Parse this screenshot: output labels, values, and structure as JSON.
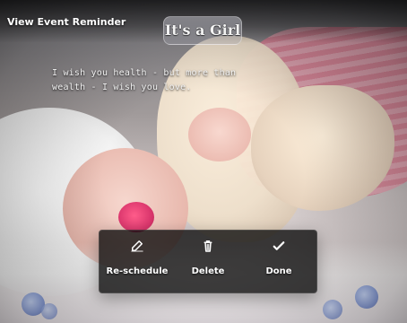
{
  "window": {
    "title": "View Event Reminder"
  },
  "header_banner": {
    "text": "It's a Girl"
  },
  "reminder": {
    "message_lines": [
      "I wish you health - but more than",
      "wealth - I wish you love."
    ]
  },
  "actions": {
    "reschedule": {
      "label": "Re-schedule",
      "icon": "edit-icon"
    },
    "delete": {
      "label": "Delete",
      "icon": "trash-icon"
    },
    "done": {
      "label": "Done",
      "icon": "check-icon"
    }
  },
  "colors": {
    "overlay": "#0a0a0a",
    "text": "#ffffff"
  }
}
